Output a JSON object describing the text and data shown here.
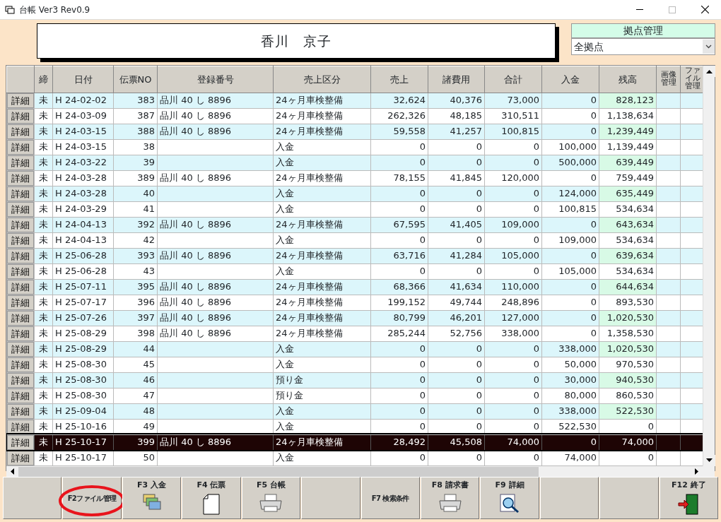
{
  "window": {
    "title": "台帳 Ver3 Rev0.9"
  },
  "customer_name": "香川　京子",
  "branch": {
    "label": "拠点管理",
    "value": "全拠点"
  },
  "table": {
    "columns": [
      "締",
      "日付",
      "伝票NO",
      "登録番号",
      "売上区分",
      "売上",
      "諸費用",
      "合計",
      "入金",
      "残高",
      "画像管理",
      "ファイル管理"
    ],
    "rows": [
      {
        "detail": "詳細",
        "cells": [
          "未",
          "H 24-02-02",
          "383",
          "品川 40 し 8896",
          "24ヶ月車検整備",
          "32,624",
          "40,376",
          "73,000",
          "0",
          "828,123"
        ],
        "selected": false
      },
      {
        "detail": "詳細",
        "cells": [
          "未",
          "H 24-03-09",
          "387",
          "品川 40 し 8896",
          "24ヶ月車検整備",
          "262,326",
          "48,185",
          "310,511",
          "0",
          "1,138,634"
        ],
        "selected": false
      },
      {
        "detail": "詳細",
        "cells": [
          "未",
          "H 24-03-15",
          "388",
          "品川 40 し 8896",
          "24ヶ月車検整備",
          "59,558",
          "41,257",
          "100,815",
          "0",
          "1,239,449"
        ],
        "selected": false
      },
      {
        "detail": "詳細",
        "cells": [
          "未",
          "H 24-03-15",
          "38",
          "",
          "入金",
          "0",
          "0",
          "0",
          "100,000",
          "1,139,449"
        ],
        "selected": false
      },
      {
        "detail": "詳細",
        "cells": [
          "未",
          "H 24-03-22",
          "39",
          "",
          "入金",
          "0",
          "0",
          "0",
          "500,000",
          "639,449"
        ],
        "selected": false
      },
      {
        "detail": "詳細",
        "cells": [
          "未",
          "H 24-03-28",
          "389",
          "品川 40 し 8896",
          "24ヶ月車検整備",
          "78,155",
          "41,845",
          "120,000",
          "0",
          "759,449"
        ],
        "selected": false
      },
      {
        "detail": "詳細",
        "cells": [
          "未",
          "H 24-03-28",
          "40",
          "",
          "入金",
          "0",
          "0",
          "0",
          "124,000",
          "635,449"
        ],
        "selected": false
      },
      {
        "detail": "詳細",
        "cells": [
          "未",
          "H 24-03-29",
          "41",
          "",
          "入金",
          "0",
          "0",
          "0",
          "100,815",
          "534,634"
        ],
        "selected": false
      },
      {
        "detail": "詳細",
        "cells": [
          "未",
          "H 24-04-13",
          "392",
          "品川 40 し 8896",
          "24ヶ月車検整備",
          "67,595",
          "41,405",
          "109,000",
          "0",
          "643,634"
        ],
        "selected": false
      },
      {
        "detail": "詳細",
        "cells": [
          "未",
          "H 24-04-13",
          "42",
          "",
          "入金",
          "0",
          "0",
          "0",
          "109,000",
          "534,634"
        ],
        "selected": false
      },
      {
        "detail": "詳細",
        "cells": [
          "未",
          "H 25-06-28",
          "393",
          "品川 40 し 8896",
          "24ヶ月車検整備",
          "63,716",
          "41,284",
          "105,000",
          "0",
          "639,634"
        ],
        "selected": false
      },
      {
        "detail": "詳細",
        "cells": [
          "未",
          "H 25-06-28",
          "43",
          "",
          "入金",
          "0",
          "0",
          "0",
          "105,000",
          "534,634"
        ],
        "selected": false
      },
      {
        "detail": "詳細",
        "cells": [
          "未",
          "H 25-07-11",
          "395",
          "品川 40 し 8896",
          "24ヶ月車検整備",
          "68,366",
          "41,634",
          "110,000",
          "0",
          "644,634"
        ],
        "selected": false
      },
      {
        "detail": "詳細",
        "cells": [
          "未",
          "H 25-07-17",
          "396",
          "品川 40 し 8896",
          "24ヶ月車検整備",
          "199,152",
          "49,744",
          "248,896",
          "0",
          "893,530"
        ],
        "selected": false
      },
      {
        "detail": "詳細",
        "cells": [
          "未",
          "H 25-07-26",
          "397",
          "品川 40 し 8896",
          "24ヶ月車検整備",
          "80,799",
          "46,201",
          "127,000",
          "0",
          "1,020,530"
        ],
        "selected": false
      },
      {
        "detail": "詳細",
        "cells": [
          "未",
          "H 25-08-29",
          "398",
          "品川 40 し 8896",
          "24ヶ月車検整備",
          "285,244",
          "52,756",
          "338,000",
          "0",
          "1,358,530"
        ],
        "selected": false
      },
      {
        "detail": "詳細",
        "cells": [
          "未",
          "H 25-08-29",
          "44",
          "",
          "入金",
          "0",
          "0",
          "0",
          "338,000",
          "1,020,530"
        ],
        "selected": false
      },
      {
        "detail": "詳細",
        "cells": [
          "未",
          "H 25-08-30",
          "45",
          "",
          "入金",
          "0",
          "0",
          "0",
          "50,000",
          "970,530"
        ],
        "selected": false
      },
      {
        "detail": "詳細",
        "cells": [
          "未",
          "H 25-08-30",
          "46",
          "",
          "預り金",
          "0",
          "0",
          "0",
          "30,000",
          "940,530"
        ],
        "selected": false
      },
      {
        "detail": "詳細",
        "cells": [
          "未",
          "H 25-08-30",
          "47",
          "",
          "預り金",
          "0",
          "0",
          "0",
          "80,000",
          "860,530"
        ],
        "selected": false
      },
      {
        "detail": "詳細",
        "cells": [
          "未",
          "H 25-09-04",
          "48",
          "",
          "入金",
          "0",
          "0",
          "0",
          "338,000",
          "522,530"
        ],
        "selected": false
      },
      {
        "detail": "詳細",
        "cells": [
          "未",
          "H 25-10-16",
          "49",
          "",
          "入金",
          "0",
          "0",
          "0",
          "522,530",
          "0"
        ],
        "selected": false
      },
      {
        "detail": "詳細",
        "cells": [
          "未",
          "H 25-10-17",
          "399",
          "品川 40 し 8896",
          "24ヶ月車検整備",
          "28,492",
          "45,508",
          "74,000",
          "0",
          "74,000"
        ],
        "selected": true
      },
      {
        "detail": "詳細",
        "cells": [
          "未",
          "H 25-10-17",
          "50",
          "",
          "入金",
          "0",
          "0",
          "0",
          "74,000",
          "0"
        ],
        "selected": false
      }
    ]
  },
  "function_keys": [
    {
      "kind": "blank"
    },
    {
      "kind": "text",
      "label": "F2ファイル管理",
      "circled": true
    },
    {
      "kind": "cards",
      "label": "F3 入金"
    },
    {
      "kind": "page",
      "label": "F4 伝票"
    },
    {
      "kind": "printer",
      "label": "F5 台帳"
    },
    {
      "kind": "blank"
    },
    {
      "kind": "text",
      "label": "F7 検索条件"
    },
    {
      "kind": "printer",
      "label": "F8 請求書"
    },
    {
      "kind": "search",
      "label": "F9 詳細"
    },
    {
      "kind": "blank"
    },
    {
      "kind": "blank"
    },
    {
      "kind": "door",
      "label": "F12 終了"
    }
  ]
}
